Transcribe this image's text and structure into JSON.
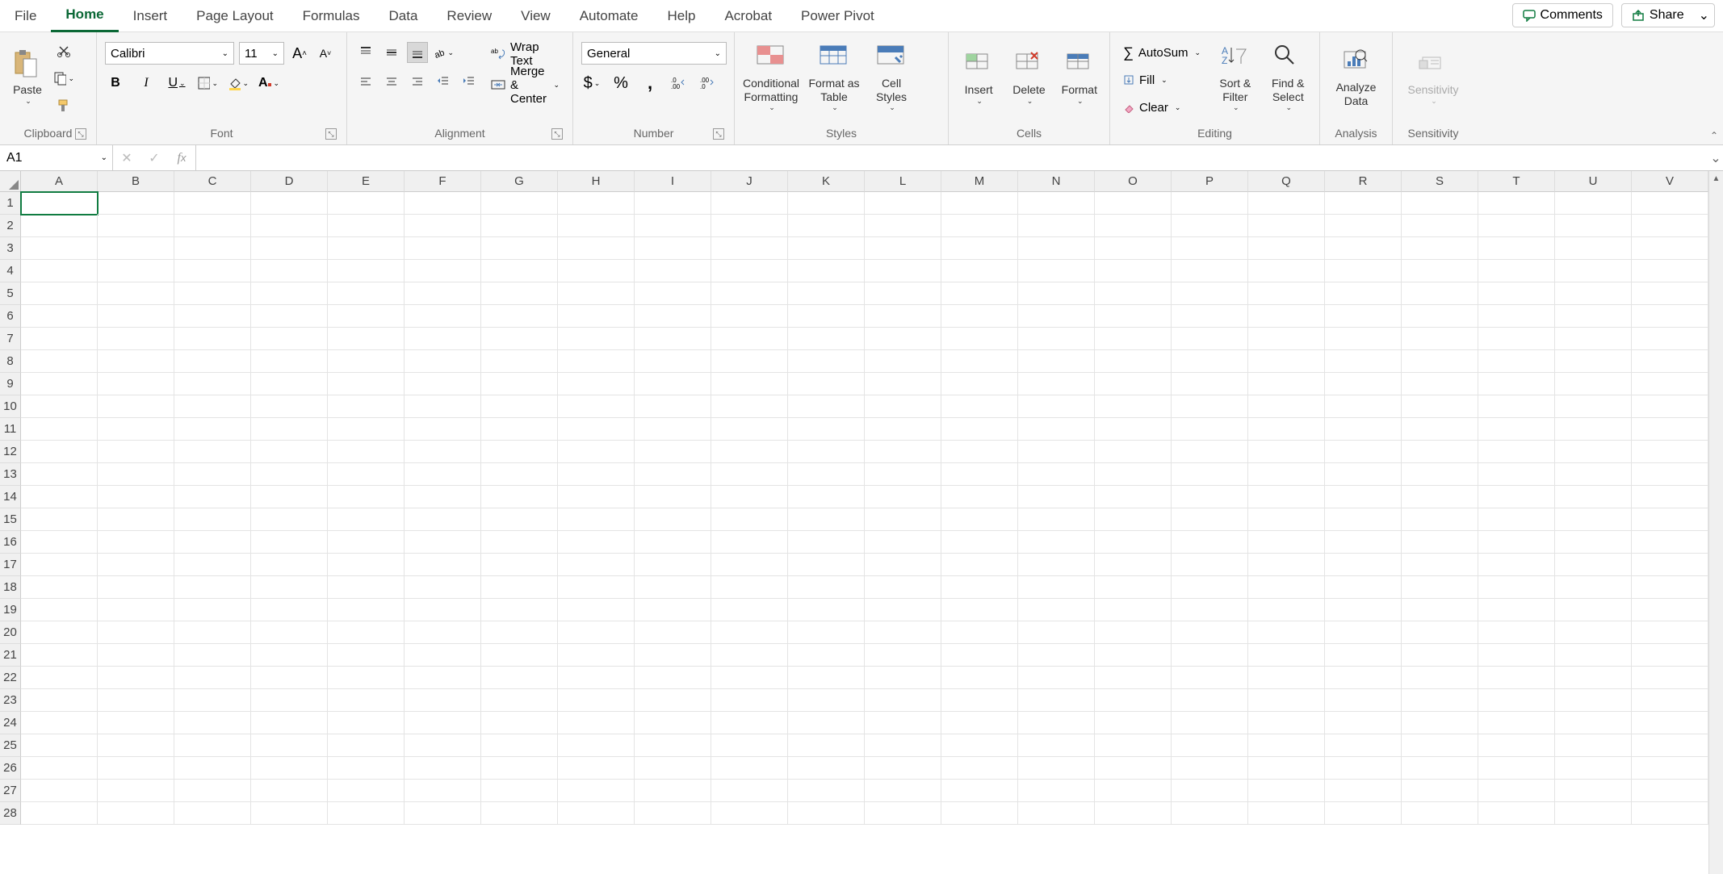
{
  "tabs": [
    "File",
    "Home",
    "Insert",
    "Page Layout",
    "Formulas",
    "Data",
    "Review",
    "View",
    "Automate",
    "Help",
    "Acrobat",
    "Power Pivot"
  ],
  "active_tab": "Home",
  "top_actions": {
    "comments": "Comments",
    "share": "Share"
  },
  "ribbon": {
    "clipboard": {
      "label": "Clipboard",
      "paste": "Paste"
    },
    "font": {
      "label": "Font",
      "font_name": "Calibri",
      "font_size": "11"
    },
    "alignment": {
      "label": "Alignment",
      "wrap": "Wrap Text",
      "merge": "Merge & Center"
    },
    "number": {
      "label": "Number",
      "format": "General"
    },
    "styles": {
      "label": "Styles",
      "conditional": "Conditional Formatting",
      "table": "Format as Table",
      "cell": "Cell Styles"
    },
    "cells": {
      "label": "Cells",
      "insert": "Insert",
      "delete": "Delete",
      "format": "Format"
    },
    "editing": {
      "label": "Editing",
      "autosum": "AutoSum",
      "fill": "Fill",
      "clear": "Clear",
      "sort": "Sort & Filter",
      "find": "Find & Select"
    },
    "analysis": {
      "label": "Analysis",
      "analyze": "Analyze Data"
    },
    "sensitivity": {
      "label": "Sensitivity",
      "btn": "Sensitivity"
    }
  },
  "name_box": "A1",
  "formula": "",
  "columns": [
    "A",
    "B",
    "C",
    "D",
    "E",
    "F",
    "G",
    "H",
    "I",
    "J",
    "K",
    "L",
    "M",
    "N",
    "O",
    "P",
    "Q",
    "R",
    "S",
    "T",
    "U",
    "V"
  ],
  "rows": [
    "1",
    "2",
    "3",
    "4",
    "5",
    "6",
    "7",
    "8",
    "9",
    "10",
    "11",
    "12",
    "13",
    "14",
    "15",
    "16",
    "17",
    "18",
    "19",
    "20",
    "21",
    "22",
    "23",
    "24",
    "25",
    "26",
    "27",
    "28"
  ],
  "active_cell": "A1"
}
